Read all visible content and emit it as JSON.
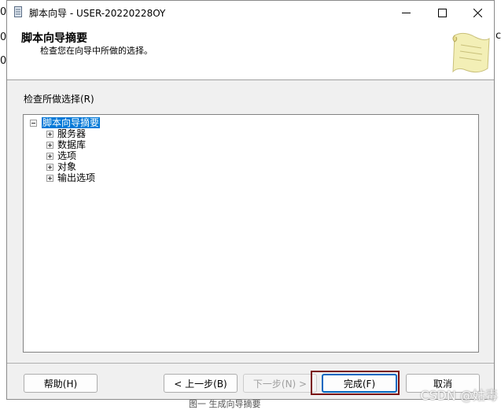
{
  "behind": {
    "left_glyph_1": "0",
    "left_glyph_2": "0",
    "left_glyph_3": "0",
    "right_glyph": "c",
    "bottom_caption": "图一  生成向导摘要"
  },
  "window": {
    "title": "脚本向导 - USER-20220228OY",
    "controls": {
      "minimize": "—",
      "maximize": "☐",
      "close": "✕"
    }
  },
  "header": {
    "title": "脚本向导摘要",
    "subtitle": "检查您在向导中所做的选择。"
  },
  "review": {
    "label": "检查所做选择(R)",
    "tree": {
      "root": "脚本向导摘要",
      "children": [
        "服务器",
        "数据库",
        "选项",
        "对象",
        "输出选项"
      ]
    }
  },
  "buttons": {
    "help": "帮助(H)",
    "back": "< 上一步(B)",
    "next": "下一步(N) >",
    "finish": "完成(F)",
    "cancel": "取消"
  },
  "watermark": "CSDN @姑毒"
}
